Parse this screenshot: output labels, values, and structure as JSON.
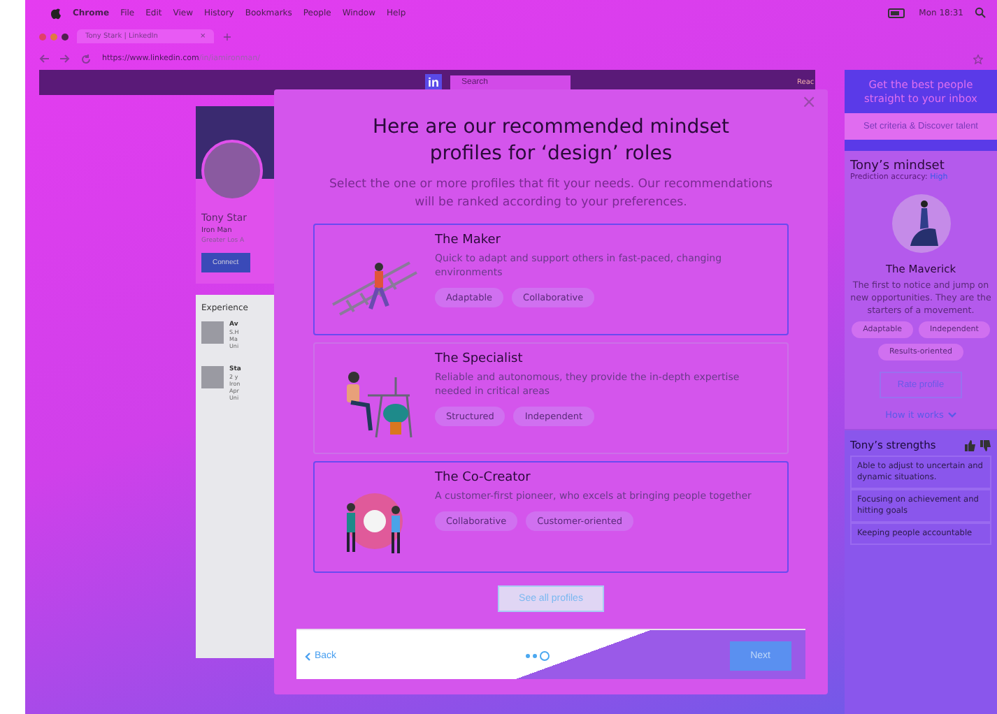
{
  "menu_bar": {
    "items": [
      "Chrome",
      "File",
      "Edit",
      "View",
      "History",
      "Bookmarks",
      "People",
      "Window",
      "Help"
    ],
    "clock": "Mon 18:31"
  },
  "browser": {
    "tab_title": "Tony Stark | LinkedIn",
    "tab_close": "×",
    "new_tab": "+",
    "url_host": "https://www.linkedin.com",
    "url_path": "/in/iamironman/"
  },
  "site_nav": {
    "logo": "in",
    "search_placeholder": "Search",
    "cut_label": "Reac"
  },
  "profile": {
    "name": "Tony Star",
    "headline": "Iron Man",
    "location": "Greater Los A",
    "connect": "Connect",
    "section": "Experience",
    "jobs": [
      {
        "title": "Av",
        "lines": [
          "S.H",
          "Ma",
          "Uni"
        ]
      },
      {
        "title": "Sta",
        "lines": [
          "2 y",
          "Iron",
          "Apr",
          "Uni"
        ]
      }
    ]
  },
  "modal": {
    "title": "Here are our recommended mindset profiles for ‘design’ roles",
    "close": "×",
    "subtitle": "Select the one or more profiles that fit your needs. Our recommendations will be ranked according to your preferences.",
    "profiles": [
      {
        "kind": "maker",
        "name": "The Maker",
        "description": "Quick to adapt and support others in fast-paced, changing environments",
        "selected": true,
        "tags": [
          "Adaptable",
          "Collaborative"
        ]
      },
      {
        "kind": "specialist",
        "name": "The Specialist",
        "description": "Reliable and autonomous, they provide the in-depth expertise needed in critical areas",
        "selected": false,
        "tags": [
          "Structured",
          "Independent"
        ]
      },
      {
        "kind": "cocreator",
        "name": "The Co-Creator",
        "description": "A customer-first pioneer, who excels at bringing people together",
        "selected": true,
        "tags": [
          "Collaborative",
          "Customer-oriented"
        ]
      }
    ],
    "see_all": "See all profiles",
    "back": "Back",
    "next": "Next",
    "steps": [
      {
        "selected": false
      },
      {
        "selected": false
      },
      {
        "selected": true
      }
    ]
  },
  "side_panel": {
    "promo": "Get the best people straight to your inbox",
    "promo_button": "Set criteria & Discover talent",
    "mindset_title": "Tony’s mindset",
    "accuracy_label": "Prediction accuracy:",
    "accuracy_value": "High",
    "profile_name": "The Maverick",
    "profile_description": "The first to notice and jump on new opportunities. They are the starters of a movement.",
    "tags": [
      "Adaptable",
      "Independent",
      "Results-oriented"
    ],
    "rate": "Rate profile",
    "how": "How it works",
    "strengths_title": "Tony’s strengths",
    "strengths": [
      "Able to adjust to uncertain and dynamic situations.",
      "Focusing on achievement and hitting goals",
      "Keeping people accountable"
    ]
  }
}
